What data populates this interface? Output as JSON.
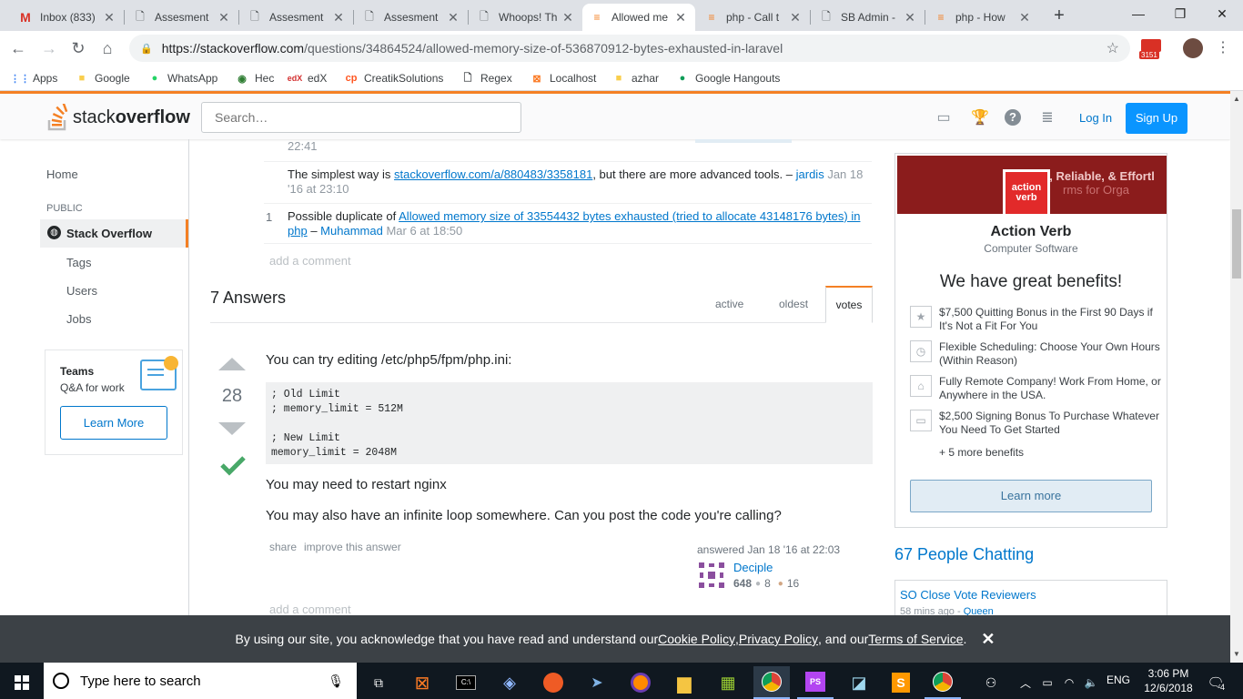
{
  "browser": {
    "tabs": [
      {
        "label": "Inbox (833)",
        "icon": "gmail-icon"
      },
      {
        "label": "Assesment",
        "icon": "doc-icon"
      },
      {
        "label": "Assesment",
        "icon": "doc-icon"
      },
      {
        "label": "Assesment",
        "icon": "doc-icon"
      },
      {
        "label": "Whoops! Th",
        "icon": "doc-icon"
      },
      {
        "label": "Allowed me",
        "icon": "stackoverflow-icon"
      },
      {
        "label": "php - Call t",
        "icon": "stackoverflow-icon"
      },
      {
        "label": "SB Admin -",
        "icon": "doc-icon"
      },
      {
        "label": "php - How",
        "icon": "stackoverflow-icon"
      }
    ],
    "url_host": "https://stackoverflow.com",
    "url_path": "/questions/34864524/allowed-memory-size-of-536870912-bytes-exhausted-in-laravel",
    "mail_badge": "3151",
    "bookmarks": [
      "Apps",
      "Google",
      "WhatsApp",
      "Hec",
      "edX",
      "CreatikSolutions",
      "Regex",
      "Localhost",
      "azhar",
      "Google Hangouts"
    ]
  },
  "so_header": {
    "logo_plain": "stack",
    "logo_bold": "overflow",
    "search_placeholder": "Search…",
    "login": "Log In",
    "signup": "Sign Up"
  },
  "leftnav": {
    "home": "Home",
    "public": "PUBLIC",
    "stack_overflow": "Stack Overflow",
    "tags": "Tags",
    "users": "Users",
    "jobs": "Jobs",
    "teams_title": "Teams",
    "teams_sub": "Q&A for work",
    "learn_more": "Learn More"
  },
  "comments": {
    "partial_time": "22:41",
    "c1_text": "The simplest way is ",
    "c1_link": "stackoverflow.com/a/880483/3358181",
    "c1_rest": ", but there are more advanced tools. –",
    "c1_user": "jardis",
    "c1_date": "Jan 18 '16 at 23:10",
    "c2_votes": "1",
    "c2_text": "Possible duplicate of ",
    "c2_link": "Allowed memory size of 33554432 bytes exhausted (tried to allocate 43148176 bytes) in php",
    "c2_sep": " – ",
    "c2_user": "Muhammad",
    "c2_date": "Mar 6 at 18:50",
    "add_comment": "add a comment"
  },
  "answers": {
    "count_label": "7 Answers",
    "sort_tabs": [
      "active",
      "oldest",
      "votes"
    ],
    "answer1": {
      "votes": "28",
      "intro": "You can try editing /etc/php5/fpm/php.ini:",
      "code": "; Old Limit\n; memory_limit = 512M\n\n; New Limit\nmemory_limit = 2048M",
      "p2": "You may need to restart nginx",
      "p3": "You may also have an infinite loop somewhere. Can you post the code you're calling?",
      "share": "share",
      "improve": "improve this answer",
      "answered": "answered Jan 18 '16 at 22:03",
      "user": "Deciple",
      "rep": "648",
      "silver": "8",
      "bronze": "16",
      "add_comment": "add a comment"
    }
  },
  "ad": {
    "banner_text": "e, Reliable, & Effortl",
    "banner_text2": "rms for Orga",
    "logo_line1": "action",
    "logo_line2": "verb",
    "company": "Action Verb",
    "industry": "Computer Software",
    "headline": "We have great benefits!",
    "benefits": [
      "$7,500 Quitting Bonus in the First 90 Days if It's Not a Fit For You",
      "Flexible Scheduling: Choose Your Own Hours (Within Reason)",
      "Fully Remote Company! Work From Home, or Anywhere in the USA.",
      "$2,500 Signing Bonus To Purchase Whatever You Need To Get Started"
    ],
    "more": "+ 5 more benefits",
    "learn_more": "Learn more"
  },
  "chat": {
    "title": "67 People Chatting",
    "room": "SO Close Vote Reviewers",
    "room_meta": "58 mins ago - ",
    "room_user": "Queen"
  },
  "cookie": {
    "prefix": "By using our site, you acknowledge that you have read and understand our ",
    "cookie_policy": "Cookie Policy",
    "comma": ", ",
    "privacy_policy": "Privacy Policy",
    "and_our": ", and our ",
    "terms": "Terms of Service",
    "dot": "."
  },
  "taskbar": {
    "search_placeholder": "Type here to search",
    "lang": "ENG",
    "time": "3:06 PM",
    "date": "12/6/2018",
    "notif_count": "4"
  },
  "colors": {
    "so_orange": "#f48024",
    "so_blue": "#0a95ff",
    "link": "#0077cc",
    "accepted": "#48a868",
    "taskbar": "#101820"
  }
}
